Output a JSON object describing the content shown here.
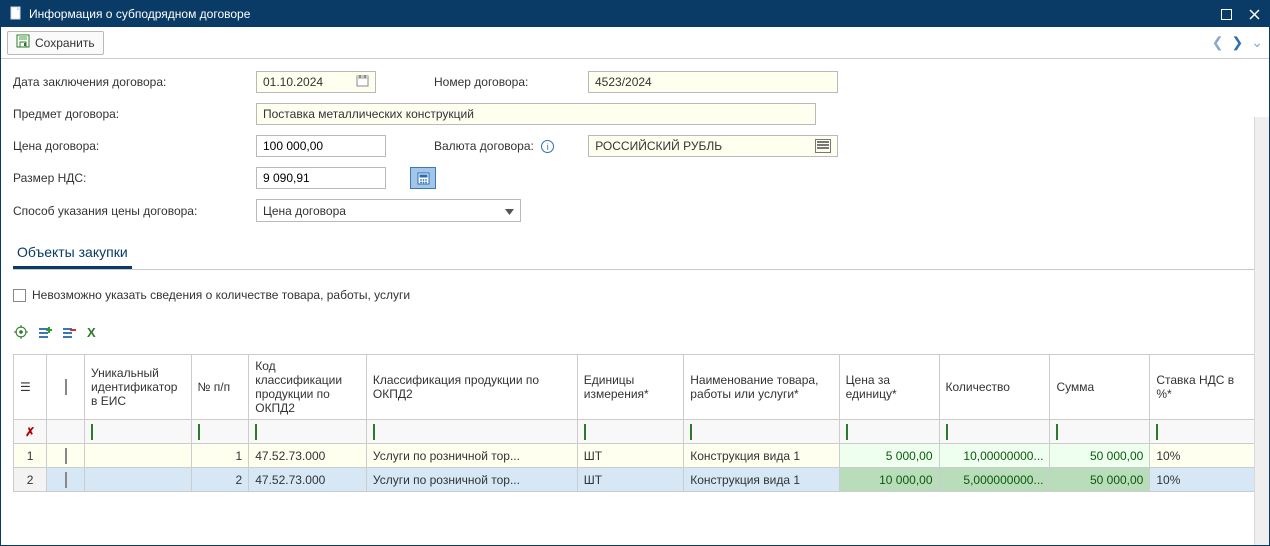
{
  "window": {
    "title": "Информация о субподрядном договоре"
  },
  "toolbar": {
    "save": "Сохранить"
  },
  "form": {
    "date_label": "Дата заключения договора:",
    "date_value": "01.10.2024",
    "number_label": "Номер договора:",
    "number_value": "4523/2024",
    "subject_label": "Предмет договора:",
    "subject_value": "Поставка металлических конструкций",
    "price_label": "Цена договора:",
    "price_value": "100 000,00",
    "currency_label": "Валюта договора:",
    "currency_value": "РОССИЙСКИЙ РУБЛЬ",
    "vat_label": "Размер НДС:",
    "vat_value": "9 090,91",
    "price_mode_label": "Способ указания цены договора:",
    "price_mode_value": "Цена договора"
  },
  "section": {
    "tab": "Объекты закупки"
  },
  "subflag": {
    "label": "Невозможно указать сведения о количестве товара, работы, услуги"
  },
  "grid": {
    "columns": {
      "eis_id": "Уникальный идентификатор в ЕИС",
      "npp": "№ п/п",
      "okpd_code": "Код классификации продукции по ОКПД2",
      "okpd_class": "Классификация продукции по ОКПД2",
      "units": "Единицы измерения*",
      "name": "Наименование товара, работы или услуги*",
      "unit_price": "Цена за единицу*",
      "qty": "Количество",
      "sum": "Сумма",
      "vat_rate": "Ставка НДС в %*"
    },
    "rows": [
      {
        "idx": "1",
        "eis": "",
        "npp": "1",
        "okpd_code": "47.52.73.000",
        "okpd_class": "Услуги по розничной тор...",
        "units": "ШТ",
        "name": "Конструкция вида 1",
        "unit_price": "5 000,00",
        "qty": "10,00000000...",
        "sum": "50 000,00",
        "vat": "10%"
      },
      {
        "idx": "2",
        "eis": "",
        "npp": "2",
        "okpd_code": "47.52.73.000",
        "okpd_class": "Услуги по розничной тор...",
        "units": "ШТ",
        "name": "Конструкция вида 1",
        "unit_price": "10 000,00",
        "qty": "5,000000000...",
        "sum": "50 000,00",
        "vat": "10%"
      }
    ]
  }
}
